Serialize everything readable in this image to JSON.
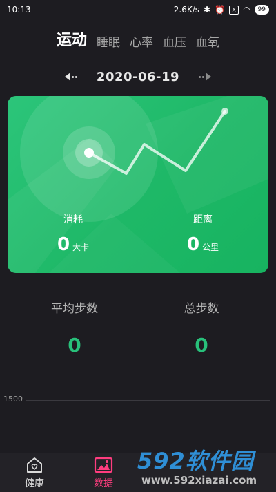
{
  "status": {
    "time": "10:13",
    "speed": "2.6K/s",
    "battery": "99",
    "box": "X"
  },
  "tabs": [
    {
      "label": "运动",
      "active": true
    },
    {
      "label": "睡眠"
    },
    {
      "label": "心率"
    },
    {
      "label": "血压"
    },
    {
      "label": "血氧"
    }
  ],
  "date": "2020-06-19",
  "card": {
    "consume_label": "消耗",
    "consume_value": "0",
    "consume_unit": "大卡",
    "distance_label": "距离",
    "distance_value": "0",
    "distance_unit": "公里"
  },
  "stats": {
    "avg_steps_label": "平均步数",
    "avg_steps_value": "0",
    "total_steps_label": "总步数",
    "total_steps_value": "0"
  },
  "chart": {
    "y_label": "1500"
  },
  "nav": [
    {
      "label": "健康",
      "active": false,
      "icon": "heart-house-icon"
    },
    {
      "label": "数据",
      "active": true,
      "icon": "data-image-icon"
    }
  ],
  "watermark": {
    "brand_num": "592",
    "brand_cn": "软件园",
    "url": "www.592xiazai.com"
  },
  "colors": {
    "accent_green": "#28c07a",
    "nav_active": "#ff3d7f",
    "background": "#1d1c21"
  }
}
